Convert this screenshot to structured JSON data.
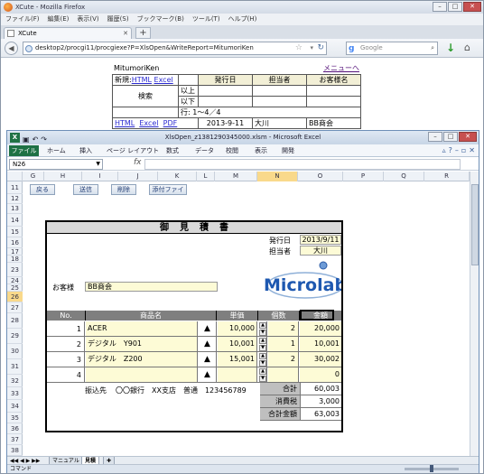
{
  "firefox": {
    "title": "XCute - Mozilla Firefox",
    "menu": [
      "ファイル(F)",
      "編集(E)",
      "表示(V)",
      "履歴(S)",
      "ブックマーク(B)",
      "ツール(T)",
      "ヘルプ(H)"
    ],
    "tab_label": "XCute",
    "url": "desktop2/procgi11/procgiexe?P=XlsOpen&WriteReport=MitumoriKen",
    "search_placeholder": "Google"
  },
  "page": {
    "user": "MitumoriKen",
    "menu_link": "メニューへ",
    "new_label": "新規:",
    "html_link": "HTML",
    "excel_link": "Excel",
    "pdf_link": "PDF",
    "search_button": "検索",
    "ge_label": "以上",
    "le_label": "以下",
    "headers": [
      "発行日",
      "担当者",
      "お客様名"
    ],
    "rows_info": "行: 1～4／4",
    "row_date": "2013-9-11",
    "row_person": "大川",
    "row_customer": "BB商会"
  },
  "excel": {
    "title": "XlsOpen_z1381290345000.xlsm - Microsoft Excel",
    "file_tab": "ファイル",
    "ribbon_tabs": [
      "ホーム",
      "挿入",
      "ページ レイアウト",
      "数式",
      "データ",
      "校閲",
      "表示",
      "開発"
    ],
    "name_box": "N26",
    "fx": "fx",
    "columns": [
      "G",
      "H",
      "I",
      "J",
      "K",
      "L",
      "M",
      "N",
      "O",
      "P",
      "Q",
      "R"
    ],
    "rows": [
      "11",
      "12",
      "13",
      "14",
      "15",
      "16",
      "17",
      "18",
      "23",
      "24",
      "25",
      "26",
      "27",
      "28",
      "29",
      "30",
      "31",
      "32",
      "33",
      "34",
      "35",
      "36",
      "37",
      "38",
      "39"
    ],
    "sheet_buttons": [
      "戻る",
      "送信",
      "削除",
      "添付ファイ"
    ],
    "sheet_tabs": [
      "マニュアル",
      "見積"
    ],
    "status": "コマンド"
  },
  "quote": {
    "title": "御見積書",
    "issue_label": "発行日",
    "issue_date": "2013/9/11",
    "person_label": "担当者",
    "person": "大川",
    "customer_label": "お客様",
    "customer": "BB商会",
    "logo_text": "Microlab",
    "col_headers": [
      "No.",
      "商品名",
      "単価",
      "個数",
      "金額"
    ],
    "items": [
      {
        "no": "1",
        "name": "ACER",
        "price": "10,000",
        "qty": "2",
        "amount": "20,000"
      },
      {
        "no": "2",
        "name": "デジタル　Y901",
        "price": "10,001",
        "qty": "1",
        "amount": "10,001"
      },
      {
        "no": "3",
        "name": "デジタル　Z200",
        "price": "15,001",
        "qty": "2",
        "amount": "30,002"
      },
      {
        "no": "4",
        "name": "",
        "price": "",
        "qty": "",
        "amount": "0"
      }
    ],
    "bank_label": "振込先",
    "bank_info": "〇〇銀行　XX支店　普通　123456789",
    "subtotal_label": "合計",
    "subtotal": "60,003",
    "tax_label": "消費税",
    "tax": "3,000",
    "total_label": "合計金額",
    "total": "63,003"
  }
}
